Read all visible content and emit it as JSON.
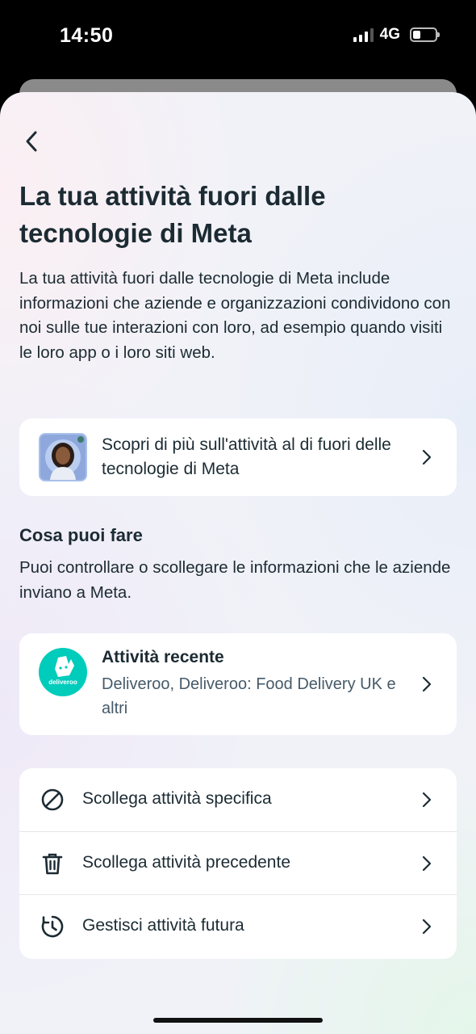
{
  "status_bar": {
    "time": "14:50",
    "network": "4G",
    "battery_level": 0.35
  },
  "header": {
    "back_icon": "chevron-left-icon",
    "title": "La tua attività fuori dalle tecnologie di Meta",
    "intro": "La tua attività fuori dalle tecnologie di Meta include informazioni che aziende e organizzazioni condividono con noi sulle tue interazioni con loro, ad esempio quando visiti le loro app o i loro siti web."
  },
  "learn_more": {
    "label": "Scopri di più sull'attività al di fuori delle tecnologie di Meta"
  },
  "section": {
    "title": "Cosa puoi fare",
    "description": "Puoi controllare o scollegare le informazioni che le aziende inviano a Meta."
  },
  "recent_activity": {
    "logo_text": "deliveroo",
    "title": "Attività recente",
    "subtitle": "Deliveroo, Deliveroo: Food Delivery UK e altri"
  },
  "actions": [
    {
      "label": "Scollega attività specifica",
      "icon": "block-icon"
    },
    {
      "label": "Scollega attività precedente",
      "icon": "trash-icon"
    },
    {
      "label": "Gestisci attività futura",
      "icon": "clock-history-icon"
    }
  ],
  "colors": {
    "deliveroo_brand": "#00ccbc",
    "text_primary": "#1c2b33",
    "text_secondary": "#465a69"
  }
}
